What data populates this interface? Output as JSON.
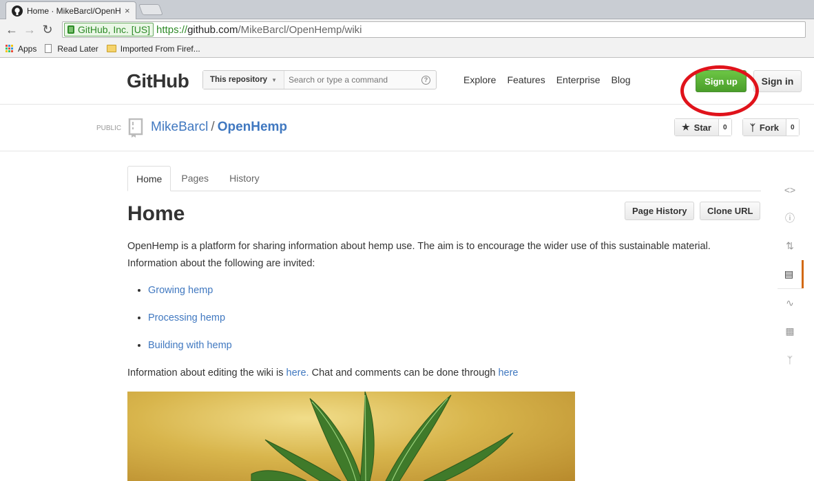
{
  "browser": {
    "tab_title": "Home · MikeBarcl/OpenH",
    "tab_close": "×",
    "ev_label": "GitHub, Inc. [US]",
    "url_scheme": "https://",
    "url_host": "github.com",
    "url_path": "/MikeBarcl/OpenHemp/wiki",
    "bookmarks": {
      "apps": "Apps",
      "read_later": "Read Later",
      "imported": "Imported From Firef..."
    }
  },
  "header": {
    "logo": "GitHub",
    "search_scope": "This repository",
    "search_placeholder": "Search or type a command",
    "nav": [
      "Explore",
      "Features",
      "Enterprise",
      "Blog"
    ],
    "signup": "Sign up",
    "signin": "Sign in"
  },
  "repo": {
    "visibility": "PUBLIC",
    "owner": "MikeBarcl",
    "separator": "/",
    "name": "OpenHemp",
    "star_label": "Star",
    "star_count": "0",
    "fork_label": "Fork",
    "fork_count": "0"
  },
  "wiki": {
    "tabs": [
      "Home",
      "Pages",
      "History"
    ],
    "title": "Home",
    "page_history": "Page History",
    "clone_url": "Clone URL",
    "intro_line1": "OpenHemp is a platform for sharing information about hemp use. The aim is to encourage the wider use of this sustainable material.",
    "intro_line2": "Information about the following are invited:",
    "links": [
      "Growing hemp",
      "Processing hemp",
      "Building with hemp"
    ],
    "footer_pre": "Information about editing the wiki is ",
    "footer_link1": "here.",
    "footer_mid": " Chat and comments can be done through ",
    "footer_link2": "here"
  },
  "colors": {
    "link": "#4078c0",
    "signup_green": "#55a532",
    "annotation_red": "#e0131b",
    "selected_nav": "#d26911"
  }
}
